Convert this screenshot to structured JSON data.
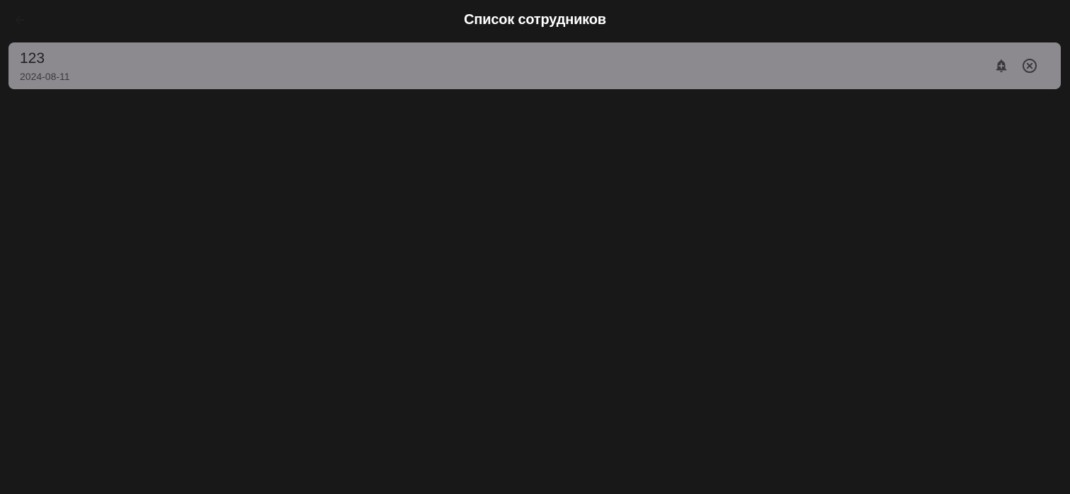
{
  "header": {
    "title": "Список сотрудников",
    "back_icon": "arrow-back-icon"
  },
  "employees": [
    {
      "name": "123",
      "date": "2024-08-11",
      "actions": [
        "bell-plus-icon",
        "close-circle-icon"
      ]
    }
  ],
  "colors": {
    "background": "#181818",
    "card": "#8c8a8f",
    "title": "#ffffff",
    "icon": "#3a383d"
  }
}
